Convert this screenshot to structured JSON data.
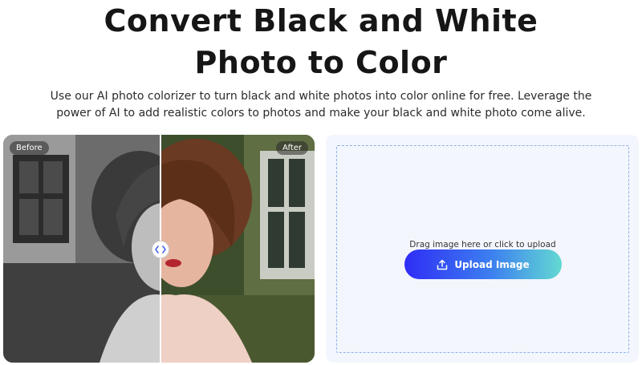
{
  "header": {
    "title_line1": "Convert Black and White",
    "title_line2": "Photo to Color",
    "subtitle": "Use our AI photo colorizer to turn black and white photos into color online for free. Leverage the power of AI to add realistic colors to photos and make your black and white photo come alive."
  },
  "comparison": {
    "before_label": "Before",
    "after_label": "After",
    "handle_icon": "chevron-left-right-icon",
    "split": 0.5
  },
  "upload": {
    "drop_text": "Drag image here or click to upload",
    "button_label": "Upload Image",
    "button_icon": "upload-icon"
  },
  "colors": {
    "button_gradient_start": "#2f2df5",
    "button_gradient_end": "#63d9d2",
    "panel_bg": "#f3f6fd",
    "dashed_border": "#8fb3e8"
  }
}
